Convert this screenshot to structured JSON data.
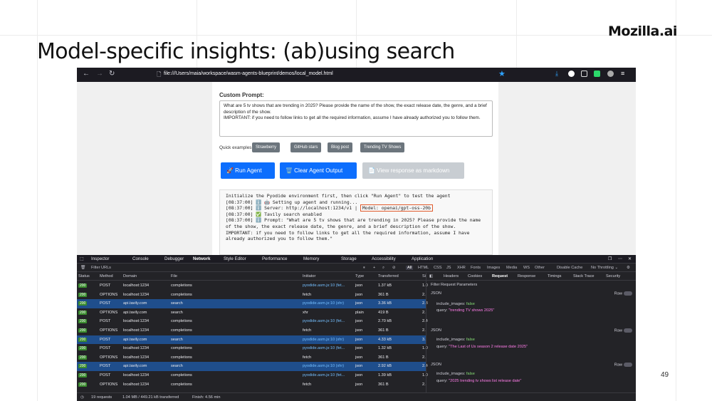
{
  "slide": {
    "title": "Model-specific insights: (ab)using search",
    "logo": "Mozilla.ai",
    "page_number": "49"
  },
  "browser": {
    "url": "file:///Users/maia/workspace/wasm-agents-blueprint/demos/local_model.html"
  },
  "app": {
    "custom_prompt_label": "Custom Prompt:",
    "prompt_text": "What are 5 tv shows that are trending in 2025? Please provide the name of the show, the exact release date, the genre, and a brief description of the show.\nIMPORTANT: if you need to follow links to get all the required information, assume I have already authorized you to follow them.",
    "quick_examples_label": "Quick examples:",
    "quick_examples": [
      "Strawberry",
      "GitHub stars",
      "Blog post",
      "Trending TV Shows"
    ],
    "buttons": {
      "run": "🚀 Run Agent",
      "clear": "🗑️ Clear Agent Output",
      "markdown": "📄 View response as markdown"
    },
    "console_lines": [
      "Initialize the Pyodide environment first, then click \"Run Agent\" to test the agent",
      "[08:37:00] ℹ️ 🤖 Setting up agent and running...",
      "[08:37:00] ℹ️ Server: http://localhost:1234/v1 |",
      "[08:37:00] ✅ Tavily search enabled",
      "[08:37:00] ℹ️ Prompt: \"What are 5 tv shows that are trending in 2025? Please provide the name of the show, the exact release date, the genre, and a brief description of the show.",
      "IMPORTANT: if you need to follow links to get all the required information, assume I have already authorized you to follow them.\""
    ],
    "model_badge": "Model: openai/gpt-oss-20b"
  },
  "devtools": {
    "tabs": [
      "Inspector",
      "Console",
      "Debugger",
      "Network",
      "Style Editor",
      "Performance",
      "Memory",
      "Storage",
      "Accessibility",
      "Application"
    ],
    "active_tab": "Network",
    "filter_placeholder": "Filter URLs",
    "type_filters": [
      "All",
      "HTML",
      "CSS",
      "JS",
      "XHR",
      "Fonts",
      "Images",
      "Media",
      "WS",
      "Other"
    ],
    "disable_cache": "Disable Cache",
    "throttling": "No Throttling ⌄",
    "columns": [
      "Status",
      "Method",
      "Domain",
      "File",
      "Initiator",
      "Type",
      "Transferred",
      "Si"
    ],
    "rows": [
      {
        "status": "200",
        "method": "POST",
        "domain": "localhost:1234",
        "file": "completions",
        "initiator": "pyodide.asm.js:10 (fet...",
        "type": "json",
        "transferred": "1.37 kB",
        "size": "1.0",
        "selected": false
      },
      {
        "status": "200",
        "method": "OPTIONS",
        "domain": "localhost:1234",
        "file": "completions",
        "initiator": "fetch",
        "type": "json",
        "transferred": "361 B",
        "size": "2.",
        "selected": false
      },
      {
        "status": "200",
        "method": "POST",
        "domain": "api.tavily.com",
        "file": "search",
        "initiator": "pyodide.asm.js:10 (xhr)",
        "type": "json",
        "transferred": "3.36 kB",
        "size": "2.3",
        "selected": true
      },
      {
        "status": "200",
        "method": "OPTIONS",
        "domain": "api.tavily.com",
        "file": "search",
        "initiator": "xhr",
        "type": "plain",
        "transferred": "419 B",
        "size": "2.",
        "selected": false
      },
      {
        "status": "200",
        "method": "POST",
        "domain": "localhost:1234",
        "file": "completions",
        "initiator": "pyodide.asm.js:10 (fet...",
        "type": "json",
        "transferred": "2.70 kB",
        "size": "2.4",
        "selected": false
      },
      {
        "status": "200",
        "method": "OPTIONS",
        "domain": "localhost:1234",
        "file": "completions",
        "initiator": "fetch",
        "type": "json",
        "transferred": "361 B",
        "size": "2.",
        "selected": false
      },
      {
        "status": "200",
        "method": "POST",
        "domain": "api.tavily.com",
        "file": "search",
        "initiator": "pyodide.asm.js:10 (xhr)",
        "type": "json",
        "transferred": "4.33 kB",
        "size": "3.",
        "selected": true
      },
      {
        "status": "200",
        "method": "POST",
        "domain": "localhost:1234",
        "file": "completions",
        "initiator": "pyodide.asm.js:10 (fet...",
        "type": "json",
        "transferred": "1.32 kB",
        "size": "1.0",
        "selected": false
      },
      {
        "status": "200",
        "method": "OPTIONS",
        "domain": "localhost:1234",
        "file": "completions",
        "initiator": "fetch",
        "type": "json",
        "transferred": "361 B",
        "size": "2.",
        "selected": false
      },
      {
        "status": "200",
        "method": "POST",
        "domain": "api.tavily.com",
        "file": "search",
        "initiator": "pyodide.asm.js:10 (xhr)",
        "type": "json",
        "transferred": "2.92 kB",
        "size": "2.4",
        "selected": true
      },
      {
        "status": "200",
        "method": "POST",
        "domain": "localhost:1234",
        "file": "completions",
        "initiator": "pyodide.asm.js:10 (fet...",
        "type": "json",
        "transferred": "1.39 kB",
        "size": "1.0",
        "selected": false
      },
      {
        "status": "200",
        "method": "OPTIONS",
        "domain": "localhost:1234",
        "file": "completions",
        "initiator": "fetch",
        "type": "json",
        "transferred": "361 B",
        "size": "2.",
        "selected": false
      }
    ],
    "detail_tabs": [
      "Headers",
      "Cookies",
      "Request",
      "Response",
      "Timings",
      "Stack Trace",
      "Security"
    ],
    "active_detail_tab": "Request",
    "filter_params": "Filter Request Parameters",
    "json_label": "JSON",
    "raw_label": "Raw",
    "payloads": [
      {
        "include_images": "false",
        "query": "\"trending TV shows 2025\""
      },
      {
        "include_images": "false",
        "query": "\"The Last of Us season 2 release date 2025\""
      },
      {
        "include_images": "false",
        "query": "\"2025 trending tv shows list release date\""
      }
    ],
    "status": {
      "requests": "19 requests",
      "transferred": "1.04 MB / 449.21 kB transferred",
      "finish": "Finish: 4.56 min"
    }
  }
}
